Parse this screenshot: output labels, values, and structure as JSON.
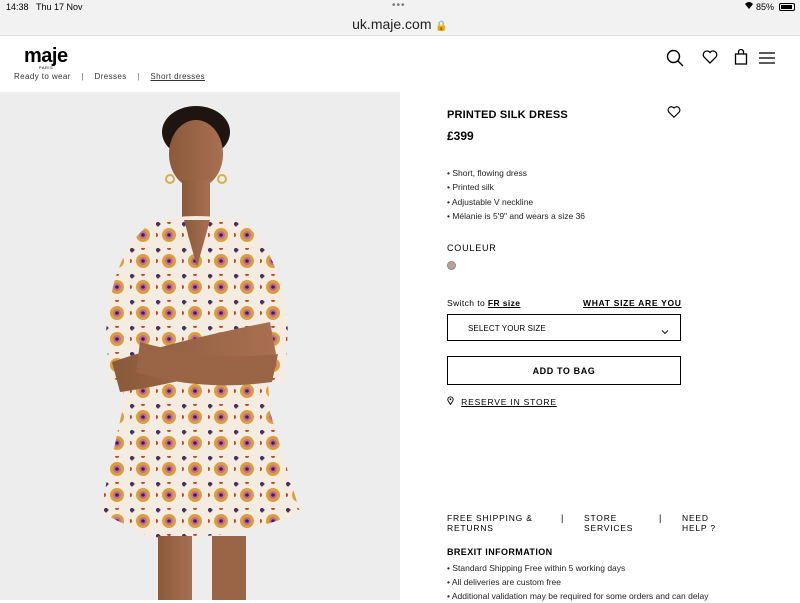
{
  "status_bar": {
    "time": "14:38",
    "date": "Thu 17 Nov",
    "battery": "85%"
  },
  "address_bar": {
    "url": "uk.maje.com"
  },
  "header": {
    "logo": "maje",
    "logo_sub": "PARIS"
  },
  "breadcrumb": [
    "Ready to wear",
    "Dresses",
    "Short dresses"
  ],
  "product": {
    "title": "PRINTED SILK DRESS",
    "price": "£399",
    "details": [
      "Short, flowing dress",
      "Printed silk",
      "Adjustable V neckline",
      "Mélanie is 5'9\" and wears a size 36"
    ],
    "colour_label": "COULEUR",
    "swatch_color": "#b8a39a",
    "switch_prefix": "Switch to",
    "switch_link": "FR size",
    "what_size": "WHAT SIZE ARE YOU",
    "size_select": "SELECT YOUR SIZE",
    "add_to_bag": "ADD TO BAG",
    "reserve": "RESERVE IN STORE"
  },
  "services": {
    "shipping": [
      "FREE SHIPPING &",
      "RETURNS"
    ],
    "stores": [
      "STORE",
      "SERVICES"
    ],
    "help": [
      "NEED",
      "HELP ?"
    ]
  },
  "brexit": {
    "title": "BREXIT INFORMATION",
    "items": [
      "Standard Shipping Free within 5 working days",
      "All deliveries are custom free",
      "Additional validation may be required for some orders and can delay"
    ]
  },
  "colors": {
    "accent": "#000000",
    "image_bg": "#ededed"
  }
}
